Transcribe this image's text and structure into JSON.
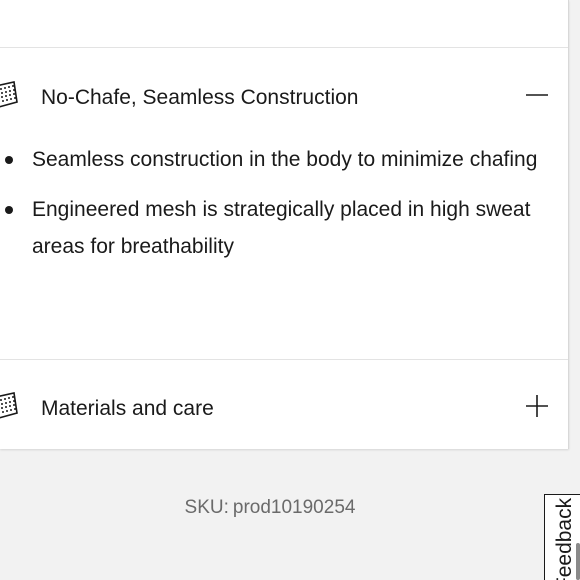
{
  "accordion": {
    "sections": [
      {
        "title": "No-Chafe, Seamless Construction",
        "icon": "fabric-swatch-icon",
        "toggle": "minus-icon",
        "expanded": true,
        "bullets": [
          "Seamless construction in the body to minimize chafing",
          "Engineered mesh is strategically placed in high sweat areas for breathability"
        ]
      },
      {
        "title": "Materials and care",
        "icon": "fabric-swatch-icon",
        "toggle": "plus-icon",
        "expanded": false
      }
    ]
  },
  "sku": {
    "label": "SKU:",
    "value": "prod10190254"
  },
  "feedback": {
    "label": "Feedback"
  },
  "colors": {
    "text": "#1a1a1a",
    "muted": "#6a6a6a",
    "background": "#f2f2f2",
    "panel": "#ffffff"
  }
}
